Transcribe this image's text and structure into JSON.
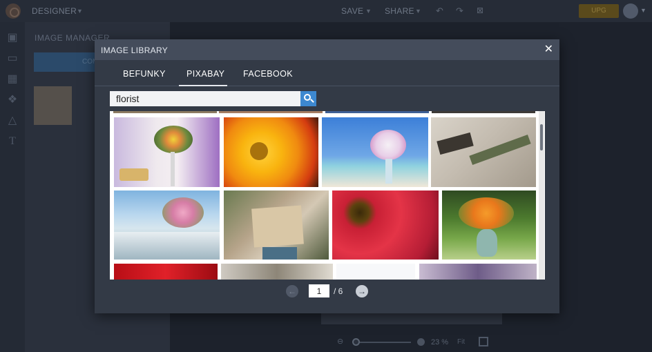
{
  "topbar": {
    "mode_label": "DESIGNER",
    "save_label": "SAVE",
    "share_label": "SHARE",
    "upgrade_label": "UPG"
  },
  "sidepanel": {
    "title": "IMAGE MANAGER",
    "button_label": "COM"
  },
  "zoom": {
    "value": "23 %",
    "fit_label": "Fit"
  },
  "modal": {
    "title": "IMAGE LIBRARY",
    "close_glyph": "✕",
    "tabs": [
      {
        "label": "BEFUNKY",
        "active": false
      },
      {
        "label": "PIXABAY",
        "active": true
      },
      {
        "label": "FACEBOOK",
        "active": false
      }
    ],
    "search": {
      "value": "florist"
    },
    "results": {
      "images": [
        {
          "name": "flower-bouquet-wedding-table"
        },
        {
          "name": "orange-gerbera-daisies"
        },
        {
          "name": "beach-orchid-arrangement"
        },
        {
          "name": "florist-tools-on-linen"
        },
        {
          "name": "banquet-table-floral-centerpiece"
        },
        {
          "name": "florist-workspace-top-view"
        },
        {
          "name": "red-gerbera-closeup"
        },
        {
          "name": "orange-roses-in-vase"
        },
        {
          "name": "red-roses"
        },
        {
          "name": "stone-wall-flowers"
        },
        {
          "name": "white-background-stems"
        },
        {
          "name": "purple-bouquet"
        }
      ]
    },
    "pager": {
      "current": "1",
      "total": "/ 6"
    },
    "accent_color": "#3d88d0"
  }
}
